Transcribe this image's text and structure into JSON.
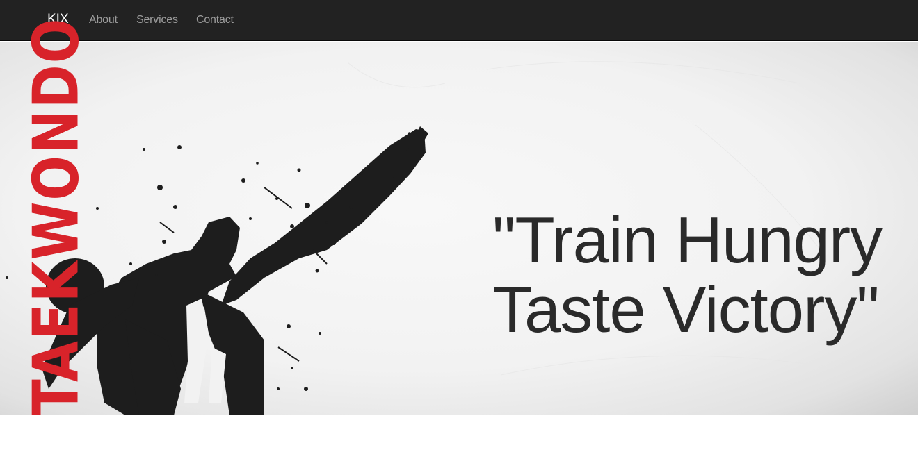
{
  "navbar": {
    "brand": "KIX",
    "links": [
      {
        "label": "About"
      },
      {
        "label": "Services"
      },
      {
        "label": "Contact"
      }
    ],
    "background": "#222222",
    "link_color": "#9d9d9d"
  },
  "hero": {
    "vertical_word": "TAEKWONDO",
    "vertical_word_color": "#d8232a",
    "quote_line_1": "\"Train Hungry",
    "quote_line_2": "Taste Victory\"",
    "illustration": "kicking-silhouette-ink-splatter"
  }
}
